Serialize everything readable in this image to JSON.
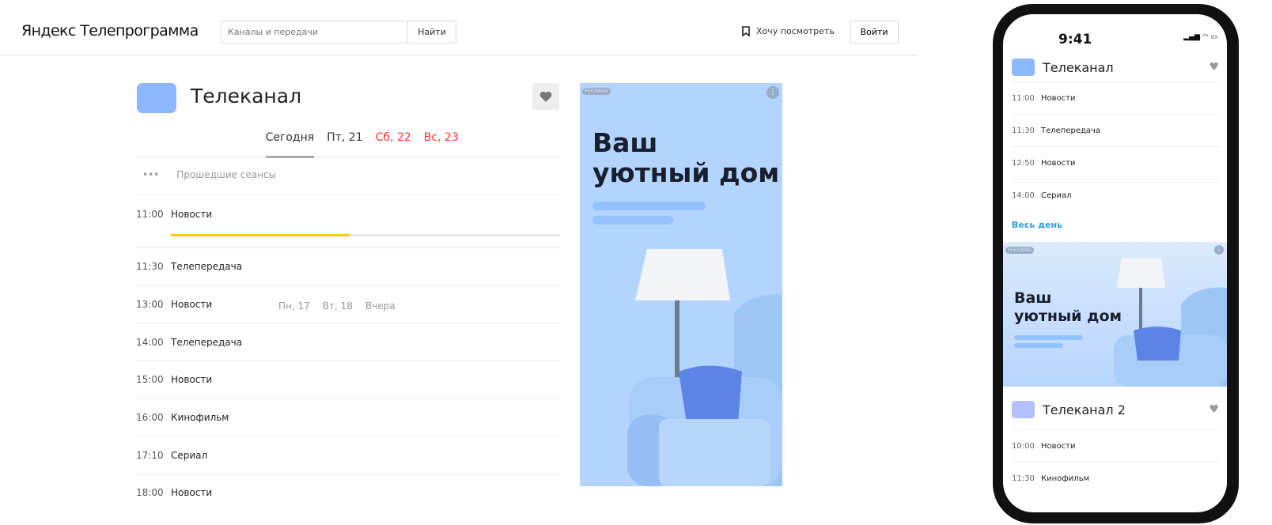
{
  "header": {
    "logo": "Яндекс Телепрограмма",
    "search_placeholder": "Каналы и передачи",
    "search_button": "Найти",
    "watchlist": "Хочу посмотреть",
    "login": "Войти"
  },
  "channel": {
    "name": "Телеканал",
    "color": "#8cb8ff"
  },
  "tabs": [
    {
      "label": "Пн, 17",
      "kind": "past"
    },
    {
      "label": "Вт, 18",
      "kind": "past"
    },
    {
      "label": "Вчера",
      "kind": "past"
    },
    {
      "label": "Сегодня",
      "kind": "active"
    },
    {
      "label": "Пт, 21",
      "kind": "dark"
    },
    {
      "label": "Сб, 22",
      "kind": "red"
    },
    {
      "label": "Вс, 23",
      "kind": "red"
    }
  ],
  "past_sessions": {
    "dots": "•••",
    "label": "Прошедшие сеансы"
  },
  "schedule": [
    {
      "time": "11:00",
      "title": "Новости",
      "progress": 46
    },
    {
      "time": "11:30",
      "title": "Телепередача"
    },
    {
      "time": "13:00",
      "title": "Новости"
    },
    {
      "time": "14:00",
      "title": "Телепередача"
    },
    {
      "time": "15:00",
      "title": "Новости"
    },
    {
      "time": "16:00",
      "title": "Кинофильм"
    },
    {
      "time": "17:10",
      "title": "Сериал"
    },
    {
      "time": "18:00",
      "title": "Новости"
    }
  ],
  "ad": {
    "label": "РЕКЛАМА",
    "title_line1": "Ваш",
    "title_line2": "уютный дом",
    "menu": "⋮"
  },
  "phone": {
    "time": "9:41",
    "status": "▂▄▆ ◠ ▭",
    "channel1": "Телеканал",
    "rows1": [
      {
        "time": "11:00",
        "title": "Новости"
      },
      {
        "time": "11:30",
        "title": "Телепередача"
      },
      {
        "time": "12:50",
        "title": "Новости"
      },
      {
        "time": "14:00",
        "title": "Сериал"
      }
    ],
    "all_day": "Весь день",
    "channel2": "Телеканал 2",
    "rows2": [
      {
        "time": "10:00",
        "title": "Новости"
      },
      {
        "time": "11:30",
        "title": "Кинофильм"
      }
    ]
  }
}
